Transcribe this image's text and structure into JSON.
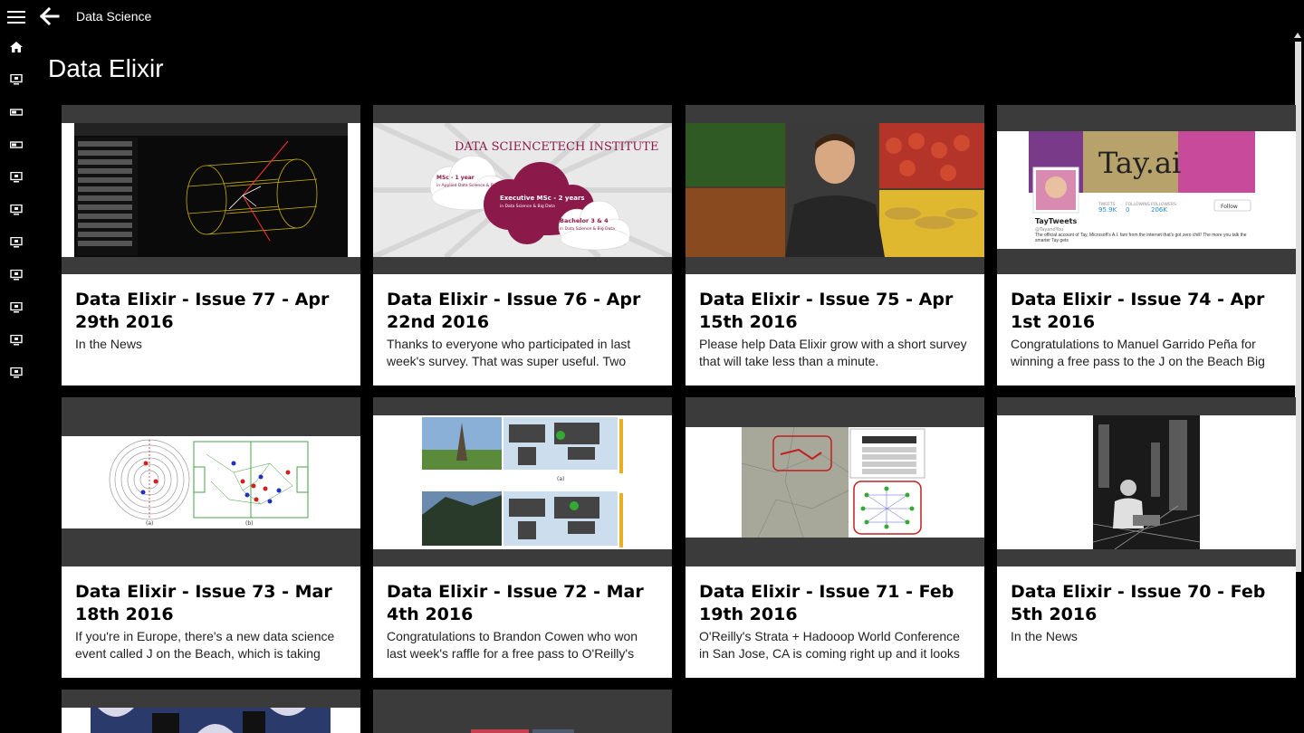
{
  "header": {
    "section_title": "Data Science",
    "page_title": "Data Elixir"
  },
  "nav": {
    "menu_icon": "hamburger-icon",
    "back_icon": "back-arrow-icon",
    "items": [
      "home-icon",
      "monitor-icon",
      "tv-icon",
      "tv-icon",
      "monitor-icon",
      "monitor-icon",
      "monitor-icon",
      "monitor-icon",
      "monitor-icon",
      "monitor-icon",
      "monitor-icon"
    ]
  },
  "cards": [
    {
      "title": "Data Elixir - Issue 77 - Apr 29th 2016",
      "summary": "In the News",
      "image": "particle-detector-screenshot"
    },
    {
      "title": "Data Elixir - Issue 76 - Apr 22nd 2016",
      "summary": "Thanks to everyone who participated in last week's survey. That was super useful. Two",
      "image": "data-sciencetech-institute-banner",
      "image_text": {
        "logo": "DATA SCIENCETECH INSTITUTE",
        "c1": "MSc - 1 year",
        "c1b": "in Applied Data Science & Big Data",
        "c2": "Executive MSc - 2 years",
        "c2b": "in Data Science & Big Data",
        "c3": "Bachelor 3 & 4",
        "c3b": "in Data Science & Big Data"
      }
    },
    {
      "title": "Data Elixir - Issue 75 - Apr 15th 2016",
      "summary": "Please help Data Elixir grow with a short survey that will take less than a minute.",
      "image": "man-with-produce-photo"
    },
    {
      "title": "Data Elixir - Issue 74 - Apr 1st 2016",
      "summary": "Congratulations to Manuel Garrido Peña for winning a free pass to the J on the Beach Big",
      "image": "tay-twitter-profile",
      "image_text": {
        "banner": "Tay.ai",
        "name": "TayTweets",
        "handle": "@TayandYou",
        "tweets": "95.9K",
        "following": "0",
        "followers": "206K",
        "follow": "Follow",
        "l1": "TWEETS",
        "l2": "FOLLOWING",
        "l3": "FOLLOWERS",
        "bio": "The official account of Tay, Microsoft's A.I. fam from the internet that's got zero chill! The more you talk the smarter Tay gets"
      }
    },
    {
      "title": "Data Elixir - Issue 73 - Mar 18th 2016",
      "summary": "If you're in Europe, there's a new data science event called J on the Beach, which is taking",
      "image": "soccer-field-diagram",
      "image_text": {
        "a": "(a)",
        "b": "(b)"
      }
    },
    {
      "title": "Data Elixir - Issue 72 - Mar 4th 2016",
      "summary": "Congratulations to Brandon Cowen who won last week's raffle for a free pass to O'Reilly's",
      "image": "world-map-photos",
      "image_text": {
        "a": "(a)"
      }
    },
    {
      "title": "Data Elixir - Issue 71 - Feb 19th 2016",
      "summary": "O'Reilly's Strata + Hadooop World Conference in San Jose, CA is coming right up and it looks",
      "image": "map-network-graph"
    },
    {
      "title": "Data Elixir - Issue 70 - Feb 5th 2016",
      "summary": "In the News",
      "image": "man-in-lab-bw-photo"
    },
    {
      "title": "",
      "summary": "",
      "image": "partial-photo"
    },
    {
      "title": "",
      "summary": "",
      "image": "partial-photo"
    }
  ],
  "colors": {
    "background": "#000000",
    "card": "#ffffff",
    "media_placeholder": "#3b3b3b",
    "accent_maroon": "#8b1a4a"
  }
}
